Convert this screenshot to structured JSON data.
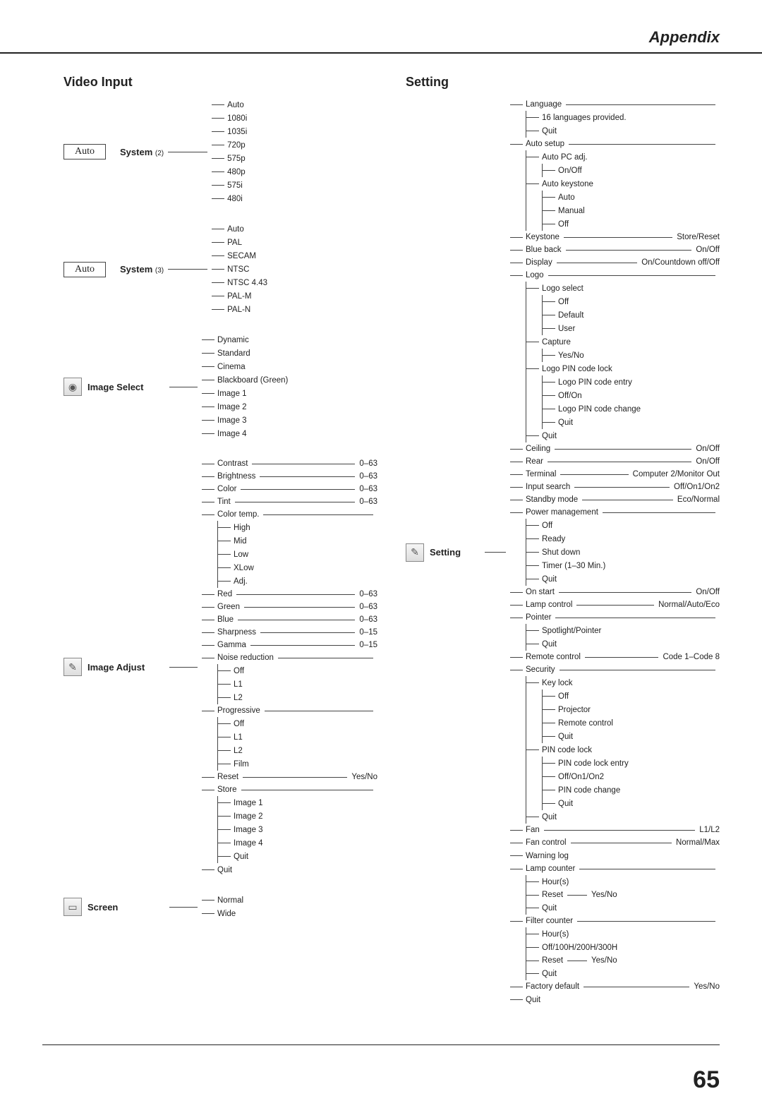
{
  "header": {
    "title": "Appendix",
    "page_number": "65"
  },
  "left": {
    "title": "Video Input",
    "system2": {
      "chip": "Auto",
      "label": "System",
      "label_suffix": "(2)",
      "items": [
        "Auto",
        "1080i",
        "1035i",
        "720p",
        "575p",
        "480p",
        "575i",
        "480i"
      ]
    },
    "system3": {
      "chip": "Auto",
      "label": "System",
      "label_suffix": "(3)",
      "items": [
        "Auto",
        "PAL",
        "SECAM",
        "NTSC",
        "NTSC 4.43",
        "PAL-M",
        "PAL-N"
      ]
    },
    "image_select": {
      "label": "Image Select",
      "items": [
        "Dynamic",
        "Standard",
        "Cinema",
        "Blackboard (Green)",
        "Image 1",
        "Image 2",
        "Image 3",
        "Image 4"
      ]
    },
    "image_adjust": {
      "label": "Image Adjust",
      "contrast": {
        "name": "Contrast",
        "value": "0–63"
      },
      "brightness": {
        "name": "Brightness",
        "value": "0–63"
      },
      "color": {
        "name": "Color",
        "value": "0–63"
      },
      "tint": {
        "name": "Tint",
        "value": "0–63"
      },
      "color_temp": {
        "name": "Color temp.",
        "items": [
          "High",
          "Mid",
          "Low",
          "XLow",
          "Adj."
        ]
      },
      "red": {
        "name": "Red",
        "value": "0–63"
      },
      "green": {
        "name": "Green",
        "value": "0–63"
      },
      "blue": {
        "name": "Blue",
        "value": "0–63"
      },
      "sharpness": {
        "name": "Sharpness",
        "value": "0–15"
      },
      "gamma": {
        "name": "Gamma",
        "value": "0–15"
      },
      "noise": {
        "name": "Noise reduction",
        "items": [
          "Off",
          "L1",
          "L2"
        ]
      },
      "progressive": {
        "name": "Progressive",
        "items": [
          "Off",
          "L1",
          "L2",
          "Film"
        ]
      },
      "reset": {
        "name": "Reset",
        "value": "Yes/No"
      },
      "store": {
        "name": "Store",
        "items": [
          "Image 1",
          "Image 2",
          "Image 3",
          "Image 4",
          "Quit"
        ]
      },
      "quit": {
        "name": "Quit"
      }
    },
    "screen": {
      "label": "Screen",
      "items": [
        "Normal",
        "Wide"
      ]
    }
  },
  "right": {
    "title": "Setting",
    "setting": {
      "label": "Setting",
      "language": {
        "name": "Language",
        "items": [
          "16 languages provided.",
          "Quit"
        ]
      },
      "auto_setup": {
        "name": "Auto setup",
        "auto_pc": {
          "name": "Auto PC adj.",
          "items": [
            "On/Off"
          ]
        },
        "auto_keystone": {
          "name": "Auto keystone",
          "items": [
            "Auto",
            "Manual",
            "Off"
          ]
        }
      },
      "keystone": {
        "name": "Keystone",
        "value": "Store/Reset"
      },
      "blue_back": {
        "name": "Blue back",
        "value": "On/Off"
      },
      "display": {
        "name": "Display",
        "value": "On/Countdown off/Off"
      },
      "logo": {
        "name": "Logo",
        "logo_select": {
          "name": "Logo select",
          "items": [
            "Off",
            "Default",
            "User"
          ]
        },
        "capture": {
          "name": "Capture",
          "items": [
            "Yes/No"
          ]
        },
        "pin_lock": {
          "name": "Logo PIN code lock",
          "items": [
            "Logo PIN code entry",
            "Off/On",
            "Logo PIN code change",
            "Quit"
          ]
        },
        "quit": "Quit"
      },
      "ceiling": {
        "name": "Ceiling",
        "value": "On/Off"
      },
      "rear": {
        "name": "Rear",
        "value": "On/Off"
      },
      "terminal": {
        "name": "Terminal",
        "value": "Computer 2/Monitor Out"
      },
      "input_search": {
        "name": "Input search",
        "value": "Off/On1/On2"
      },
      "standby": {
        "name": "Standby mode",
        "value": "Eco/Normal"
      },
      "power_mgmt": {
        "name": "Power management",
        "items": [
          "Off",
          "Ready",
          "Shut down",
          "Timer (1–30 Min.)",
          "Quit"
        ]
      },
      "on_start": {
        "name": "On start",
        "value": "On/Off"
      },
      "lamp_control": {
        "name": "Lamp control",
        "value": "Normal/Auto/Eco"
      },
      "pointer": {
        "name": "Pointer",
        "items": [
          "Spotlight/Pointer",
          "Quit"
        ]
      },
      "remote": {
        "name": "Remote control",
        "value": "Code 1–Code 8"
      },
      "security": {
        "name": "Security",
        "key_lock": {
          "name": "Key lock",
          "items": [
            "Off",
            "Projector",
            "Remote control",
            "Quit"
          ]
        },
        "pin_lock": {
          "name": "PIN code lock",
          "items": [
            "PIN code lock entry",
            "Off/On1/On2",
            "PIN code change",
            "Quit"
          ]
        },
        "quit": "Quit"
      },
      "fan": {
        "name": "Fan",
        "value": "L1/L2"
      },
      "fan_control": {
        "name": "Fan control",
        "value": "Normal/Max"
      },
      "warning": {
        "name": "Warning log"
      },
      "lamp_counter": {
        "name": "Lamp counter",
        "hours": "Hour(s)",
        "reset": {
          "name": "Reset",
          "value": "Yes/No"
        },
        "quit": "Quit"
      },
      "filter_counter": {
        "name": "Filter counter",
        "hours": "Hour(s)",
        "off": "Off/100H/200H/300H",
        "reset": {
          "name": "Reset",
          "value": "Yes/No"
        },
        "quit": "Quit"
      },
      "factory": {
        "name": "Factory default",
        "value": "Yes/No"
      },
      "quit": "Quit"
    }
  }
}
